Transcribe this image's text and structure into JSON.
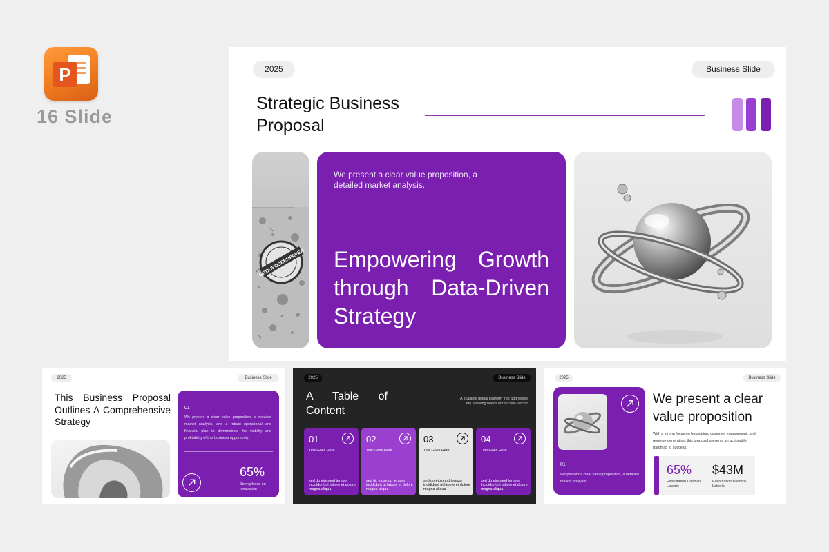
{
  "badge": {
    "app_letter": "P",
    "slide_count": "16 Slide"
  },
  "main_slide": {
    "year": "2025",
    "tag": "Business Slide",
    "title": "Strategic Business Proposal",
    "hero_subtitle": "We present a clear value proposition, a detailed market analysis.",
    "hero_title": "Empowering Growth through Data-Driven Strategy",
    "stamp_text": "GROUPOSEENPAPER",
    "bar_colors": [
      "#c58be6",
      "#9a3fd0",
      "#7a1fb0"
    ]
  },
  "thumb1": {
    "year": "2025",
    "tag": "Business Slide",
    "heading": "This Business Proposal Outlines A Comprehensive Strategy",
    "num": "01",
    "text": "We present a clear value proposition, a detailed market analysis, and a robust operational and financial plan to demonstrate the viability and profitability of this business opportunity.",
    "percent": "65%",
    "caption": "Strong focus on Innovation"
  },
  "thumb2": {
    "year": "2025",
    "tag": "Business Slide",
    "heading": "A Table of Content",
    "description": "A scalable digital platform that addresses the evolving needs of the SME sector",
    "items": [
      {
        "num": "01",
        "title": "Title Goes Here",
        "body": "sed do eiusmod tempor incididunt ut labore et dolore magna aliqua",
        "bg": "#7a1fb0",
        "fg": "#ffffff"
      },
      {
        "num": "02",
        "title": "Title Goes Here",
        "body": "sed do eiusmod tempor incididunt ut labore et dolore magna aliqua",
        "bg": "#9a3fd0",
        "fg": "#ffffff"
      },
      {
        "num": "03",
        "title": "Title Goes Here",
        "body": "sed do eiusmod tempor incididunt ut labore et dolore magna aliqua",
        "bg": "#e6e6e6",
        "fg": "#111111"
      },
      {
        "num": "04",
        "title": "Title Goes Here",
        "body": "sed do eiusmod tempor incididunt ut labore et dolore magna aliqua",
        "bg": "#7a1fb0",
        "fg": "#ffffff"
      }
    ]
  },
  "thumb3": {
    "year": "2025",
    "tag": "Business Slide",
    "heading": "We present a clear value proposition",
    "paragraph": "With a strong focus on Innovation, customer engagement, and revenue generation, this proposal presents an actionable roadmap to success.",
    "num": "01",
    "text": "We present a clear value proposition, a detailed market analysis.",
    "stat1_value": "65%",
    "stat1_caption": "Exercitation Ullamco Laboris",
    "stat2_value": "$43M",
    "stat2_caption": "Exercitation Ullamco Laboris"
  }
}
